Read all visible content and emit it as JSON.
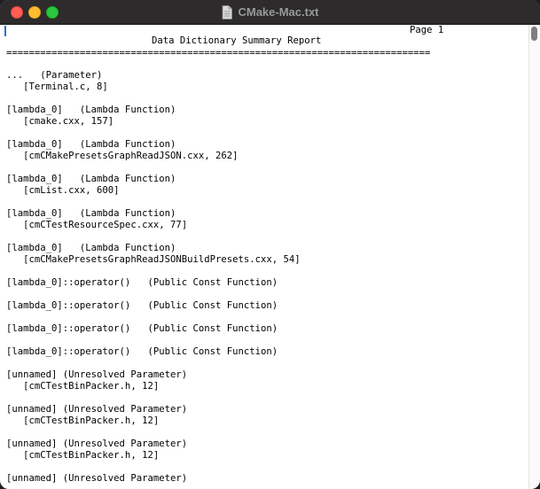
{
  "window": {
    "title": "CMake-Mac.txt",
    "icon": "document-icon"
  },
  "report": {
    "page_label": "Page 1",
    "heading": "Data Dictionary Summary Report",
    "rule": "==========================================================================="
  },
  "entries": [
    {
      "name": "...",
      "kind": "(Parameter)",
      "location": "[Terminal.c, 8]"
    },
    {
      "name": "[lambda_0]",
      "kind": "(Lambda Function)",
      "location": "[cmake.cxx, 157]"
    },
    {
      "name": "[lambda_0]",
      "kind": "(Lambda Function)",
      "location": "[cmCMakePresetsGraphReadJSON.cxx, 262]"
    },
    {
      "name": "[lambda_0]",
      "kind": "(Lambda Function)",
      "location": "[cmList.cxx, 600]"
    },
    {
      "name": "[lambda_0]",
      "kind": "(Lambda Function)",
      "location": "[cmCTestResourceSpec.cxx, 77]"
    },
    {
      "name": "[lambda_0]",
      "kind": "(Lambda Function)",
      "location": "[cmCMakePresetsGraphReadJSONBuildPresets.cxx, 54]"
    },
    {
      "name": "[lambda_0]::operator()",
      "kind": "(Public Const Function)",
      "location": ""
    },
    {
      "name": "[lambda_0]::operator()",
      "kind": "(Public Const Function)",
      "location": ""
    },
    {
      "name": "[lambda_0]::operator()",
      "kind": "(Public Const Function)",
      "location": ""
    },
    {
      "name": "[lambda_0]::operator()",
      "kind": "(Public Const Function)",
      "location": ""
    },
    {
      "name": "[unnamed]",
      "kind": "(Unresolved Parameter)",
      "location": "[cmCTestBinPacker.h, 12]"
    },
    {
      "name": "[unnamed]",
      "kind": "(Unresolved Parameter)",
      "location": "[cmCTestBinPacker.h, 12]"
    },
    {
      "name": "[unnamed]",
      "kind": "(Unresolved Parameter)",
      "location": "[cmCTestBinPacker.h, 12]"
    },
    {
      "name": "[unnamed]",
      "kind": "(Unresolved Parameter)",
      "location": ""
    }
  ],
  "colors": {
    "titlebar": "#2d2b2c",
    "close": "#ff5f57",
    "minimize": "#febc2e",
    "zoom": "#28c840",
    "cursor": "#2a6fd6"
  }
}
